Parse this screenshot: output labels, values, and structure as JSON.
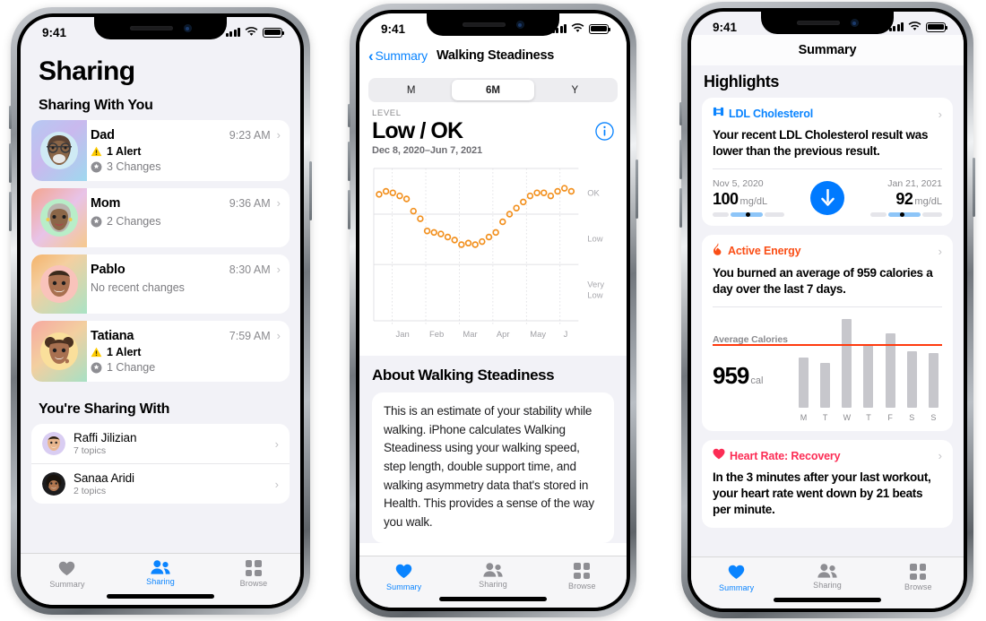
{
  "colors": {
    "accent_blue": "#0a84ff",
    "orange": "#f2901e",
    "red": "#ff3b30",
    "pink_red": "#fc2d55",
    "active_energy": "#fa4e16",
    "avg_line": "#ff3b0f",
    "bar_gray": "#c7c7cc",
    "bg": "#f2f2f7",
    "card": "#ffffff"
  },
  "phone1": {
    "status": {
      "time": "9:41"
    },
    "page_title": "Sharing",
    "section1_title": "Sharing With You",
    "shared_with_you": [
      {
        "name": "Dad",
        "time": "9:23 AM",
        "alert": "1 Alert",
        "changes": "3 Changes"
      },
      {
        "name": "Mom",
        "time": "9:36 AM",
        "alert": "",
        "changes": "2 Changes"
      },
      {
        "name": "Pablo",
        "time": "8:30 AM",
        "alert": "",
        "changes": "No recent changes"
      },
      {
        "name": "Tatiana",
        "time": "7:59 AM",
        "alert": "1 Alert",
        "changes": "1 Change"
      }
    ],
    "section2_title": "You're Sharing With",
    "sharing_with": [
      {
        "name": "Raffi Jilizian",
        "sub": "7 topics"
      },
      {
        "name": "Sanaa Aridi",
        "sub": "2 topics"
      }
    ],
    "tabs": [
      {
        "label": "Summary",
        "icon": "heart-icon",
        "active": false
      },
      {
        "label": "Sharing",
        "icon": "people-icon",
        "active": true
      },
      {
        "label": "Browse",
        "icon": "grid-icon",
        "active": false
      }
    ]
  },
  "phone2": {
    "status": {
      "time": "9:41"
    },
    "back_label": "Summary",
    "nav_title": "Walking Steadiness",
    "segments": [
      {
        "label": "M",
        "selected": false
      },
      {
        "label": "6M",
        "selected": true
      },
      {
        "label": "Y",
        "selected": false
      }
    ],
    "level_caption": "LEVEL",
    "level_value": "Low / OK",
    "date_range": "Dec 8, 2020–Jun 7, 2021",
    "info_icon": "info-circle-icon",
    "about_heading": "About Walking Steadiness",
    "about_text": "This is an estimate of your stability while walking. iPhone calculates Walking Steadiness using your walking speed, step length, double support time, and walking asymmetry data that's stored in Health. This provides a sense of the way you walk.",
    "tabs": [
      {
        "label": "Summary",
        "icon": "heart-icon",
        "active": true
      },
      {
        "label": "Sharing",
        "icon": "people-icon",
        "active": false
      },
      {
        "label": "Browse",
        "icon": "grid-icon",
        "active": false
      }
    ],
    "chart_data": {
      "type": "scatter",
      "title": "Walking Steadiness",
      "xlabel": "",
      "ylabel": "Level",
      "grid": true,
      "legend_position": "none",
      "marker": "open-circle",
      "marker_color": "#f2901e",
      "x_tick_labels": [
        "Jan",
        "Feb",
        "Mar",
        "Apr",
        "May",
        "J"
      ],
      "y_tick_labels": [
        "OK",
        "Low",
        "Very Low"
      ],
      "y_tick_values": [
        82,
        52,
        22
      ],
      "ylim": [
        0,
        100
      ],
      "values": [
        83,
        85,
        84,
        82,
        80,
        72,
        67,
        59,
        58,
        57,
        55,
        53,
        50,
        51,
        50,
        52,
        55,
        58,
        65,
        70,
        74,
        78,
        82,
        84,
        84,
        82,
        85,
        87,
        85
      ]
    }
  },
  "phone3": {
    "status": {
      "time": "9:41"
    },
    "nav_title": "Summary",
    "highlights_title": "Highlights",
    "cards": [
      {
        "type": "ldl",
        "icon": "lab-results-icon",
        "label": "LDL Cholesterol",
        "label_color": "#0a84ff",
        "description": "Your recent LDL Cholesterol result was lower than the previous result.",
        "left": {
          "date": "Nov 5, 2020",
          "value": "100",
          "unit": "mg/dL"
        },
        "right": {
          "date": "Jan 21, 2021",
          "value": "92",
          "unit": "mg/dL"
        },
        "trend_icon": "arrow-down-icon"
      },
      {
        "type": "active_energy",
        "icon": "flame-icon",
        "label": "Active Energy",
        "label_color": "#fa4e16",
        "description": "You burned an average of 959 calories a day over the last 7 days.",
        "chart_data": {
          "type": "bar",
          "title": "Average Calories",
          "xlabel": "",
          "ylabel": "Calories",
          "categories": [
            "M",
            "T",
            "W",
            "T",
            "F",
            "S",
            "S"
          ],
          "values": [
            780,
            690,
            1380,
            990,
            1160,
            870,
            850
          ],
          "average_label": "Average Calories",
          "average_value": "959",
          "average_unit": "cal",
          "average_line": 959,
          "ylim": [
            0,
            1450
          ],
          "grid": false,
          "bar_color": "#c7c7cc",
          "avg_line_color": "#ff3b0f"
        }
      },
      {
        "type": "heart_rate",
        "icon": "heart-filled-icon",
        "label": "Heart Rate: Recovery",
        "label_color": "#fc2d55",
        "description": "In the 3 minutes after your last workout, your heart rate went down by 21 beats per minute."
      }
    ],
    "tabs": [
      {
        "label": "Summary",
        "icon": "heart-icon",
        "active": true
      },
      {
        "label": "Sharing",
        "icon": "people-icon",
        "active": false
      },
      {
        "label": "Browse",
        "icon": "grid-icon",
        "active": false
      }
    ]
  }
}
